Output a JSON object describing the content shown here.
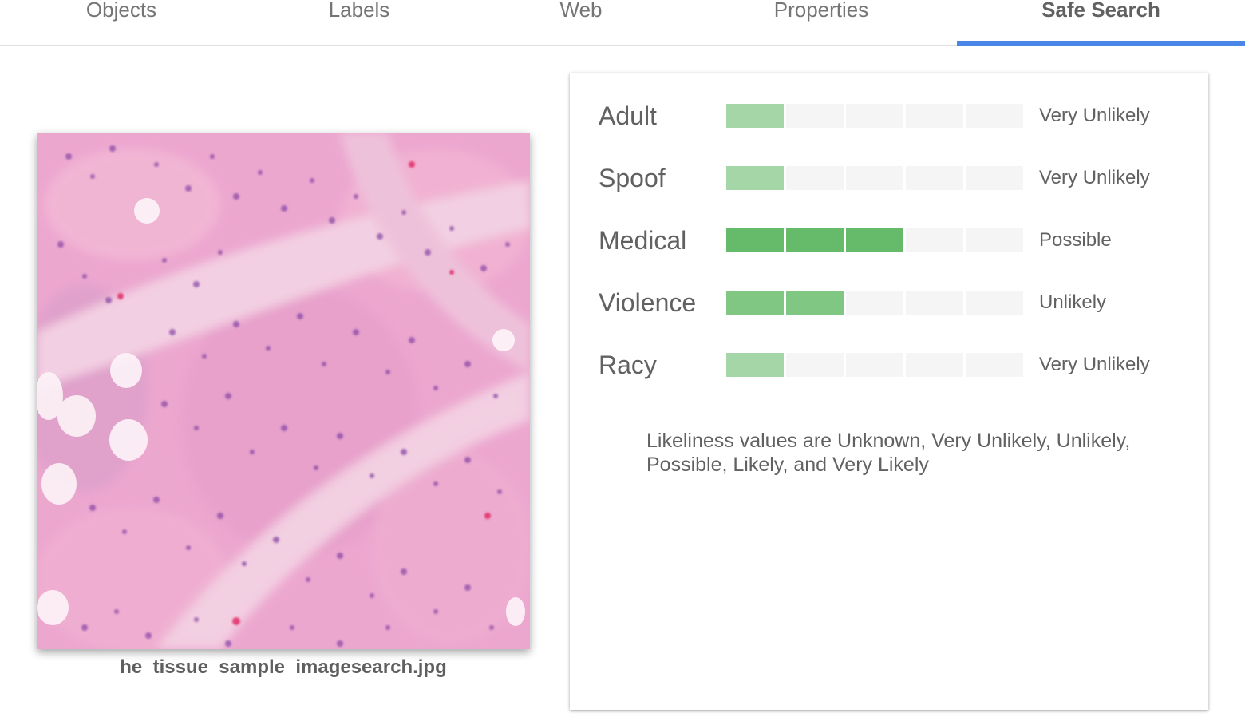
{
  "tabs": [
    {
      "label": "Objects",
      "active": false
    },
    {
      "label": "Labels",
      "active": false
    },
    {
      "label": "Web",
      "active": false
    },
    {
      "label": "Properties",
      "active": false
    },
    {
      "label": "Safe Search",
      "active": true
    }
  ],
  "image": {
    "caption": "he_tissue_sample_imagesearch.jpg"
  },
  "safe_search": {
    "rows": [
      {
        "label": "Adult",
        "value": "Very Unlikely",
        "level": 1
      },
      {
        "label": "Spoof",
        "value": "Very Unlikely",
        "level": 1
      },
      {
        "label": "Medical",
        "value": "Possible",
        "level": 3
      },
      {
        "label": "Violence",
        "value": "Unlikely",
        "level": 2
      },
      {
        "label": "Racy",
        "value": "Very Unlikely",
        "level": 1
      }
    ],
    "segments_total": 5,
    "note": "Likeliness values are Unknown, Very Unlikely, Unlikely, Possible, Likely, and Very Likely"
  },
  "colors": {
    "accent": "#4a86e8",
    "level_1": "#a5d6a7",
    "level_2": "#81c784",
    "level_3": "#66bb6a",
    "empty_segment": "#f5f5f5"
  }
}
